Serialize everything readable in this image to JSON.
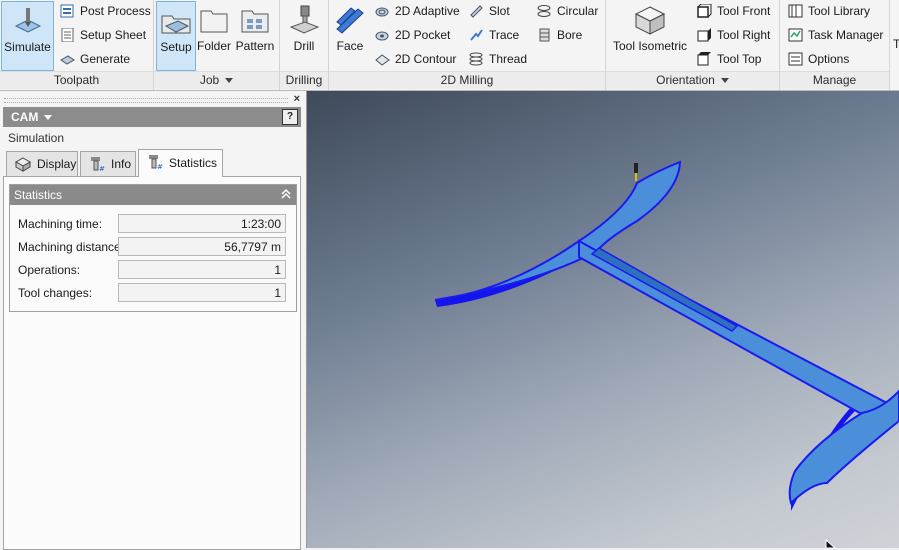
{
  "ribbon": {
    "toolpath": {
      "label": "Toolpath",
      "simulate": "Simulate",
      "post_process": "Post Process",
      "setup_sheet": "Setup Sheet",
      "generate": "Generate"
    },
    "job": {
      "label": "Job",
      "setup": "Setup",
      "folder": "Folder",
      "pattern": "Pattern"
    },
    "drilling": {
      "label": "Drilling",
      "drill": "Drill"
    },
    "milling": {
      "label": "2D Milling",
      "face": "Face",
      "adaptive": "2D Adaptive",
      "pocket": "2D Pocket",
      "contour": "2D Contour",
      "slot": "Slot",
      "trace": "Trace",
      "thread": "Thread",
      "circular": "Circular",
      "bore": "Bore"
    },
    "orientation": {
      "label": "Orientation",
      "tool_isometric": "Tool Isometric",
      "tool_front": "Tool Front",
      "tool_right": "Tool Right",
      "tool_top": "Tool Top"
    },
    "manage": {
      "label": "Manage",
      "tool_library": "Tool Library",
      "task_manager": "Task Manager",
      "options": "Options"
    },
    "overflow_letter": "T"
  },
  "panel": {
    "close": "×",
    "title": "CAM",
    "help": "?",
    "subtitle": "Simulation",
    "tabs": [
      {
        "label": "Display"
      },
      {
        "label": "Info"
      },
      {
        "label": "Statistics"
      }
    ],
    "active_tab": "Statistics",
    "statistics": {
      "header": "Statistics",
      "rows": [
        {
          "label": "Machining time:",
          "value": "1:23:00"
        },
        {
          "label": "Machining distance:",
          "value": "56,7797 m"
        },
        {
          "label": "Operations:",
          "value": "1"
        },
        {
          "label": "Tool changes:",
          "value": "1"
        }
      ]
    }
  },
  "colors": {
    "part_top": "#4a8fdc",
    "part_edge": "#1212ee",
    "active_button_bg": "#cfe6f8",
    "panel_header": "#8c8c8c"
  }
}
